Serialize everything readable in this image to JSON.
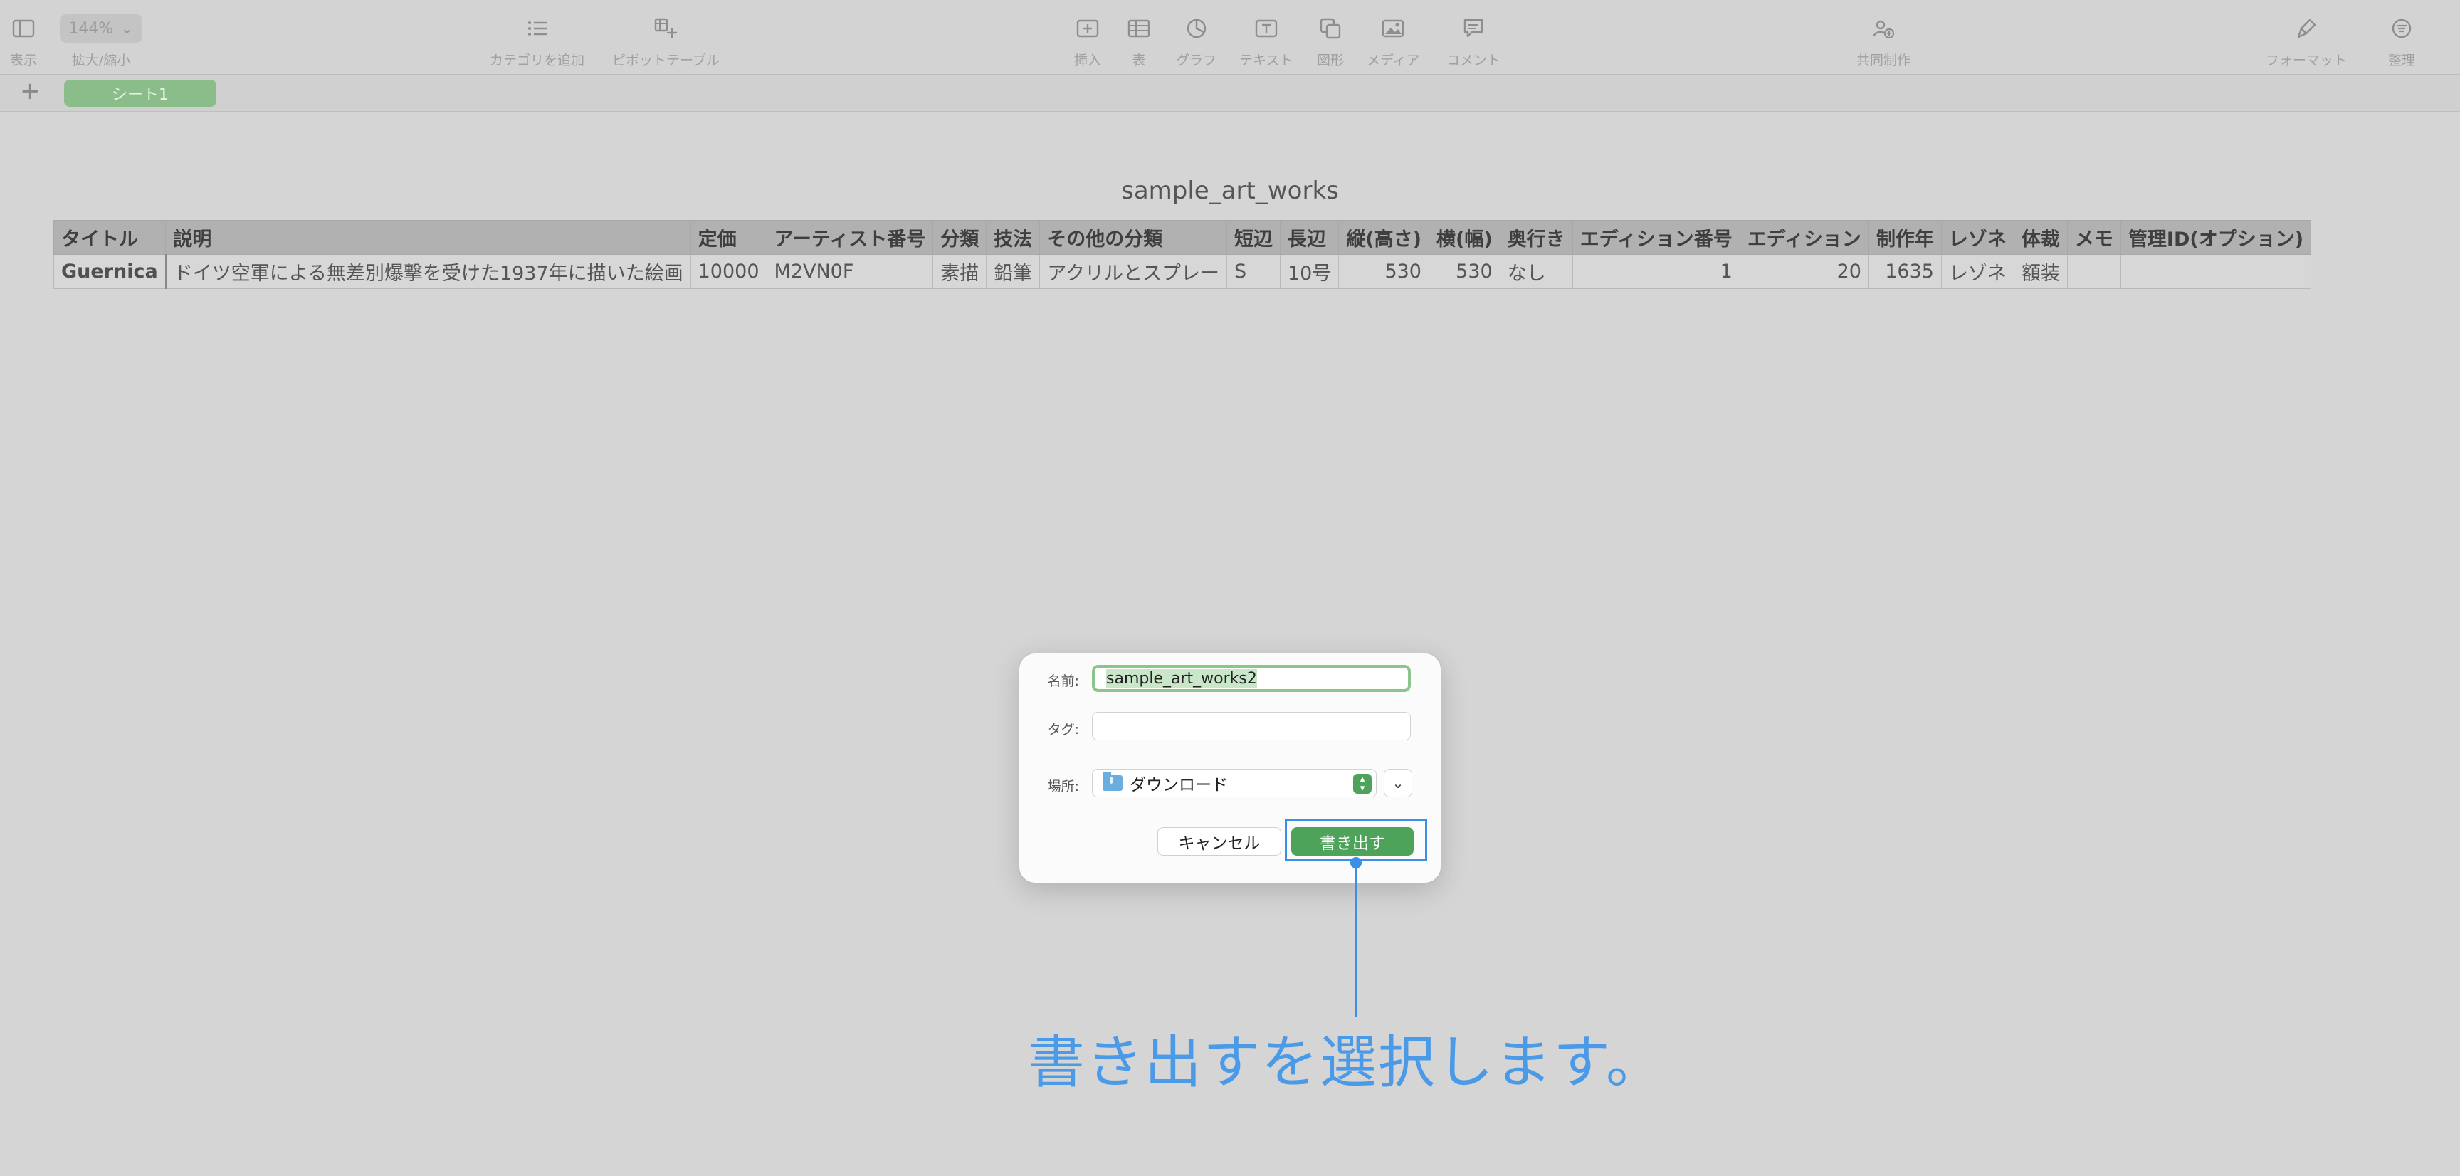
{
  "toolbar": {
    "view_label": "表示",
    "zoom_value": "144%",
    "zoom_label": "拡大/縮小",
    "add_category_label": "カテゴリを追加",
    "pivot_label": "ピボットテーブル",
    "insert_label": "挿入",
    "table_label": "表",
    "chart_label": "グラフ",
    "text_label": "テキスト",
    "shape_label": "図形",
    "media_label": "メディア",
    "comment_label": "コメント",
    "collab_label": "共同制作",
    "format_label": "フォーマット",
    "organize_label": "整理"
  },
  "tabs": {
    "add_symbol": "+",
    "sheet1": "シート1"
  },
  "table": {
    "title": "sample_art_works",
    "headers": [
      "タイトル",
      "説明",
      "定価",
      "アーティスト番号",
      "分類",
      "技法",
      "その他の分類",
      "短辺",
      "長辺",
      "縦(高さ)",
      "横(幅)",
      "奥行き",
      "エディション番号",
      "エディション",
      "制作年",
      "レゾネ",
      "体裁",
      "メモ",
      "管理ID(オプション)"
    ],
    "rows": [
      [
        "Guernica",
        "ドイツ空軍による無差別爆撃を受けた1937年に描いた絵画",
        "10000",
        "M2VN0F",
        "素描",
        "鉛筆",
        "アクリルとスプレー",
        "S",
        "10号",
        "530",
        "530",
        "なし",
        "1",
        "20",
        "1635",
        "レゾネ",
        "額装",
        "",
        ""
      ]
    ]
  },
  "dialog": {
    "name_label": "名前:",
    "name_value": "sample_art_works2",
    "tag_label": "タグ:",
    "tag_value": "",
    "location_label": "場所:",
    "location_value": "ダウンロード",
    "cancel_label": "キャンセル",
    "export_label": "書き出す"
  },
  "annotation": {
    "text": "書き出すを選択します。",
    "accent_color": "#3a8fe6"
  },
  "colors": {
    "sheet_tab": "#8bbd8a",
    "primary_button": "#4ea35a"
  }
}
